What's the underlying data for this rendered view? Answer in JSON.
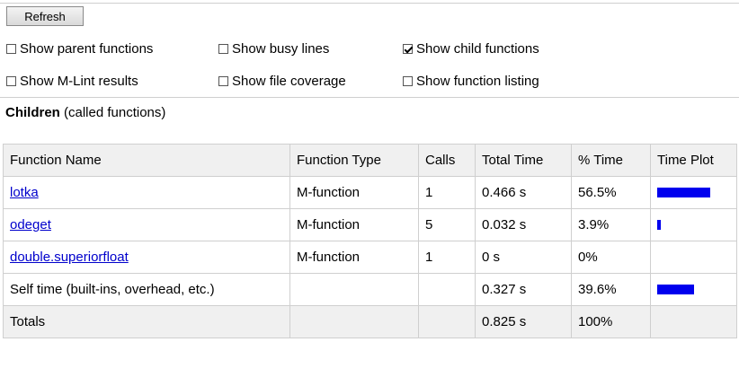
{
  "toolbar": {
    "refresh_label": "Refresh"
  },
  "options": [
    {
      "label": "Show parent functions",
      "checked": false
    },
    {
      "label": "Show busy lines",
      "checked": false
    },
    {
      "label": "Show child functions",
      "checked": true
    },
    {
      "label": "Show M-Lint results",
      "checked": false
    },
    {
      "label": "Show file coverage",
      "checked": false
    },
    {
      "label": "Show function listing",
      "checked": false
    }
  ],
  "section": {
    "title_bold": "Children",
    "title_rest": " (called functions)"
  },
  "table": {
    "headers": [
      "Function Name",
      "Function Type",
      "Calls",
      "Total Time",
      "% Time",
      "Time Plot"
    ],
    "rows": [
      {
        "name": "lotka",
        "type": "M-function",
        "calls": "1",
        "total": "0.466 s",
        "pct": "56.5%",
        "plot_fraction": 0.565
      },
      {
        "name": "odeget",
        "type": "M-function",
        "calls": "5",
        "total": "0.032 s",
        "pct": "3.9%",
        "plot_fraction": 0.039
      },
      {
        "name": "double.superiorfloat",
        "type": "M-function",
        "calls": "1",
        "total": "0 s",
        "pct": "0%",
        "plot_fraction": 0
      },
      {
        "name": "Self time (built-ins, overhead, etc.)",
        "type": "",
        "calls": "",
        "total": "0.327 s",
        "pct": "39.6%",
        "plot_fraction": 0.396
      }
    ],
    "totals": {
      "label": "Totals",
      "total": "0.825 s",
      "pct": "100%"
    }
  },
  "colors": {
    "bar": "#0000ee",
    "link": "#0000cc",
    "header_bg": "#f0f0f0"
  }
}
